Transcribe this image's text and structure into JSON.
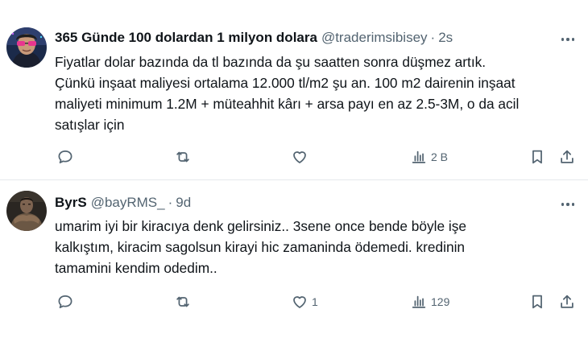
{
  "tweets": [
    {
      "author": {
        "name": "365 Günde 100 dolardan 1 milyon dolara",
        "handle": "@traderimsibisey",
        "separator": "·",
        "time": "2s"
      },
      "lines": [
        "Fiyatlar dolar bazında da tl bazında da şu saatten sonra düşmez artık.",
        "Çünkü inşaat maliyesi ortalama 12.000 tl/m2 şu an. 100 m2 dairenin inşaat",
        "maliyeti minimum 1.2M + müteahhit kârı + arsa payı en az 2.5-3M, o da acil",
        "satışlar için"
      ],
      "stats": {
        "replies": "",
        "retweets": "",
        "likes": "",
        "views": "2 B"
      }
    },
    {
      "author": {
        "name": "ByrS",
        "handle": "@bayRMS_",
        "separator": "·",
        "time": "9d"
      },
      "lines": [
        "umarim iyi bir kiracıya denk gelirsiniz.. 3sene once bende böyle işe",
        "kalkıştım, kiracim sagolsun kirayi hic zamaninda ödemedi. kredinin",
        "tamamini kendim odedim.."
      ],
      "stats": {
        "replies": "",
        "retweets": "",
        "likes": "1",
        "views": "129"
      }
    }
  ],
  "icons": {
    "reply": "reply-icon",
    "retweet": "retweet-icon",
    "like": "heart-icon",
    "views": "views-icon",
    "bookmark": "bookmark-icon",
    "share": "share-icon",
    "more": "more-icon"
  },
  "colors": {
    "text_primary": "#0f1419",
    "text_secondary": "#536471",
    "divider": "#e6e9ec"
  }
}
